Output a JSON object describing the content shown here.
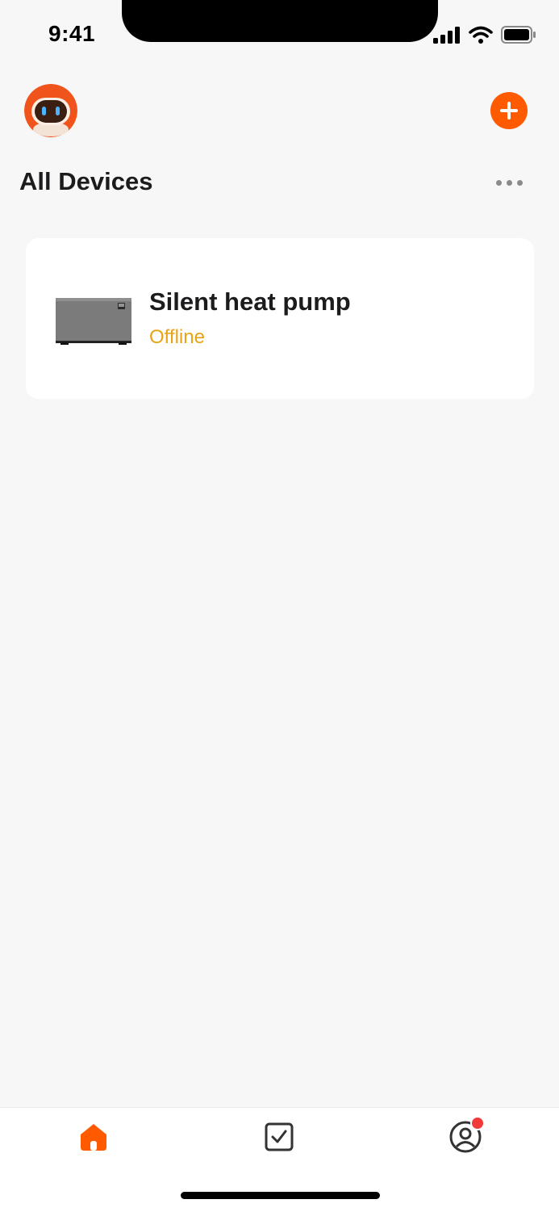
{
  "status_bar": {
    "time": "9:41",
    "icons": [
      "signal-icon",
      "wifi-icon",
      "battery-icon"
    ]
  },
  "header": {
    "avatar_icon": "robot-avatar-icon",
    "add_icon": "plus-icon",
    "title": "All Devices",
    "more_icon": "ellipsis-icon"
  },
  "devices": [
    {
      "name": "Silent heat pump",
      "status": "Offline",
      "image_icon": "heat-pump-icon"
    }
  ],
  "tab_bar": {
    "tabs": [
      {
        "icon": "home-icon",
        "active": true
      },
      {
        "icon": "checkbox-icon",
        "active": false
      },
      {
        "icon": "user-icon",
        "active": false,
        "has_badge": true
      }
    ]
  },
  "colors": {
    "accent": "#ff5a00",
    "status_offline": "#e8a317",
    "badge": "#f13a3a",
    "background": "#f7f7f7"
  }
}
